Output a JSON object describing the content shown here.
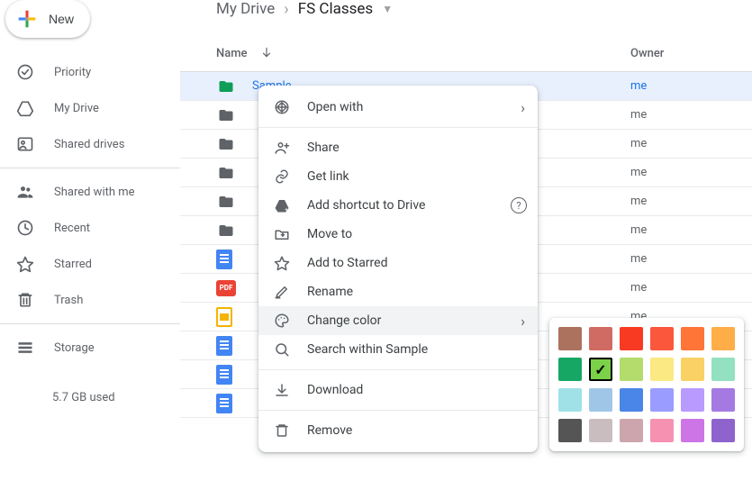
{
  "new_button": {
    "label": "New"
  },
  "sidebar": {
    "items": [
      {
        "label": "Priority"
      },
      {
        "label": "My Drive"
      },
      {
        "label": "Shared drives"
      },
      {
        "label": "Shared with me"
      },
      {
        "label": "Recent"
      },
      {
        "label": "Starred"
      },
      {
        "label": "Trash"
      },
      {
        "label": "Storage"
      }
    ],
    "storage_used": "5.7 GB used"
  },
  "breadcrumb": {
    "parts": [
      "My Drive",
      "FS Classes"
    ]
  },
  "list": {
    "columns": {
      "name": "Name",
      "owner": "Owner"
    },
    "rows": [
      {
        "type": "folder-green",
        "name": "Sample",
        "owner": "me",
        "selected": true
      },
      {
        "type": "folder",
        "name": "",
        "owner": "me"
      },
      {
        "type": "folder",
        "name": "",
        "owner": "me"
      },
      {
        "type": "folder",
        "name": "",
        "owner": "me"
      },
      {
        "type": "folder",
        "name": "",
        "owner": "me"
      },
      {
        "type": "folder",
        "name": "",
        "owner": "me"
      },
      {
        "type": "doc",
        "name": "",
        "owner": "me"
      },
      {
        "type": "pdf",
        "name": "",
        "owner": "me"
      },
      {
        "type": "slides",
        "name": "",
        "owner": "me"
      },
      {
        "type": "doc",
        "name": "",
        "owner": ""
      },
      {
        "type": "doc",
        "name": "",
        "owner": ""
      },
      {
        "type": "doc",
        "name": "",
        "owner": ""
      }
    ]
  },
  "context_menu": {
    "items": [
      {
        "label": "Open with",
        "has_submenu": true
      },
      {
        "label": "Share"
      },
      {
        "label": "Get link"
      },
      {
        "label": "Add shortcut to Drive",
        "has_help": true
      },
      {
        "label": "Move to"
      },
      {
        "label": "Add to Starred"
      },
      {
        "label": "Rename"
      },
      {
        "label": "Change color",
        "has_submenu": true,
        "hovered": true
      },
      {
        "label": "Search within Sample"
      },
      {
        "label": "Download"
      },
      {
        "label": "Remove"
      }
    ]
  },
  "color_picker": {
    "rows": [
      [
        "#ac725e",
        "#d06b64",
        "#f83a22",
        "#fa573c",
        "#ff7537",
        "#ffad46"
      ],
      [
        "#16a765",
        "#7bd148",
        "#b3dc6c",
        "#fbe983",
        "#fad165",
        "#92e1c0"
      ],
      [
        "#9fe1e7",
        "#9fc6e7",
        "#4986e7",
        "#9a9cff",
        "#b99aff",
        "#a47ae2"
      ],
      [
        "#555555",
        "#cabdbf",
        "#cca6ac",
        "#f691b2",
        "#cd74e6",
        "#8e63ce"
      ]
    ],
    "selected_index": [
      1,
      1
    ]
  },
  "icons": {
    "pdf_text": "PDF"
  }
}
